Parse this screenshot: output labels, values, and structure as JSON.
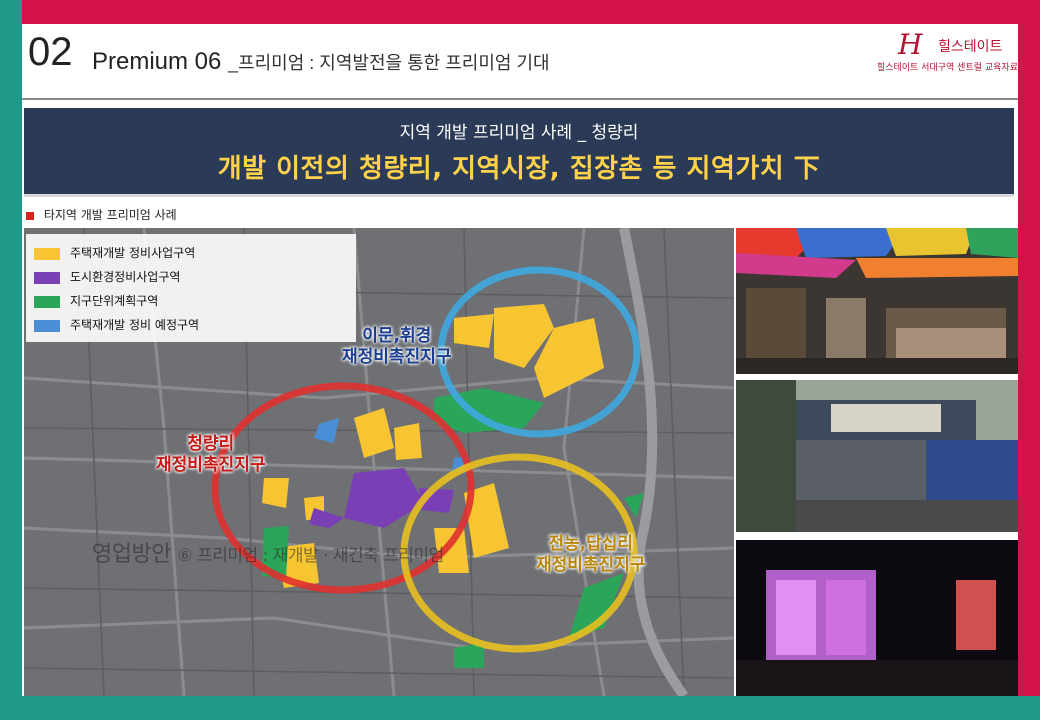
{
  "header": {
    "section_number": "02",
    "title": "Premium 06",
    "subtitle": "_프리미엄 : 지역발전을 통한 프리미엄 기대",
    "logo_mark": "H",
    "logo_text": "힐스테이트",
    "logo_sub": "힐스테이트 서대구역 센트럴 교육자료"
  },
  "banner": {
    "small": "지역 개발 프리미엄 사례 _ 청량리",
    "big": "개발 이전의 청량리, 지역시장, 집장촌 등 지역가치 下"
  },
  "section_label": "타지역 개발 프리미엄 사례",
  "legend": {
    "items": [
      {
        "label": "주택재개발 정비사업구역",
        "color": "#f7c531"
      },
      {
        "label": "도시환경정비사업구역",
        "color": "#7b3fb5"
      },
      {
        "label": "지구단위계획구역",
        "color": "#2aa55a"
      },
      {
        "label": "주택재개발 정비 예정구역",
        "color": "#4a8fd6"
      }
    ]
  },
  "districts": {
    "blue": {
      "line1": "이문,휘경",
      "line2": "재정비촉진지구",
      "color": "#3fa9e0"
    },
    "red": {
      "line1": "청량리",
      "line2": "재정비촉진지구",
      "color": "#e03030"
    },
    "yellow": {
      "line1": "전농,답십리",
      "line2": "재정비촉진지구",
      "color": "#e8c020"
    }
  },
  "watermark": {
    "main": "영업방안",
    "sub": "⑥ 프리미엄 : 재개발 · 재건축 프리미엄"
  }
}
